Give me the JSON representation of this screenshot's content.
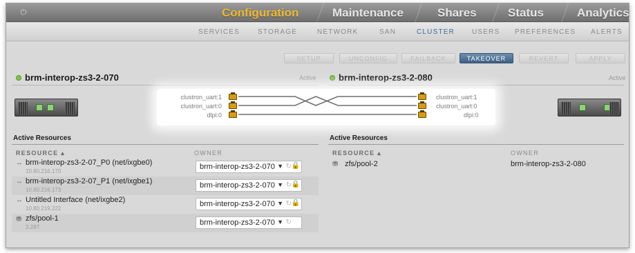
{
  "nav": {
    "tabs": [
      {
        "label": "Configuration",
        "active": true
      },
      {
        "label": "Maintenance",
        "active": false
      },
      {
        "label": "Shares",
        "active": false
      },
      {
        "label": "Status",
        "active": false
      },
      {
        "label": "Analytics",
        "active": false
      }
    ],
    "subtabs": [
      {
        "label": "SERVICES"
      },
      {
        "label": "STORAGE"
      },
      {
        "label": "NETWORK"
      },
      {
        "label": "SAN"
      },
      {
        "label": "CLUSTER"
      },
      {
        "label": "USERS"
      },
      {
        "label": "PREFERENCES"
      },
      {
        "label": "ALERTS"
      }
    ]
  },
  "actions": {
    "setup": "SETUP",
    "unconfig": "UNCONFIG",
    "failback": "FAILBACK",
    "takeover": "TAKEOVER",
    "revert": "REVERT",
    "apply": "APPLY"
  },
  "nodes": {
    "left": {
      "name": "brm-interop-zs3-2-070",
      "state": "Active"
    },
    "right": {
      "name": "brm-interop-zs3-2-080",
      "state": "Active"
    }
  },
  "links": {
    "left": [
      "clustron_uart:1",
      "clustron_uart:0",
      "dlpi:0"
    ],
    "right": [
      "clustron_uart:1",
      "clustron_uart:0",
      "dlpi:0"
    ]
  },
  "left_resources": {
    "title": "Active Resources",
    "col_resource": "RESOURCE ▴",
    "col_owner": "OWNER",
    "rows": [
      {
        "icon": "↔",
        "name": "brm-interop-zs3-2-07_P0 (net/ixgbe0)",
        "sub": "10.80.216.170",
        "owner": "brm-interop-zs3-2-070"
      },
      {
        "icon": "↔",
        "name": "brm-interop-zs3-2-07_P1 (net/ixgbe1)",
        "sub": "10.80.216.173",
        "owner": "brm-interop-zs3-2-070"
      },
      {
        "icon": "↔",
        "name": "Untitled Interface (net/ixgbe2)",
        "sub": "10.80.219.222",
        "owner": "brm-interop-zs3-2-070"
      },
      {
        "icon": "⛃",
        "name": "zfs/pool-1",
        "sub": "3.28T",
        "owner": "brm-interop-zs3-2-070"
      }
    ]
  },
  "right_resources": {
    "title": "Active Resources",
    "col_resource": "RESOURCE ▴",
    "col_owner": "OWNER",
    "rows": [
      {
        "icon": "⛃",
        "name": "zfs/pool-2",
        "owner": "brm-interop-zs3-2-080"
      }
    ]
  },
  "colors": {
    "active_tab": "#f0b830",
    "primary_button": "#4b6d91",
    "status_dot": "#7fc24a",
    "port": "#d79a1a"
  }
}
